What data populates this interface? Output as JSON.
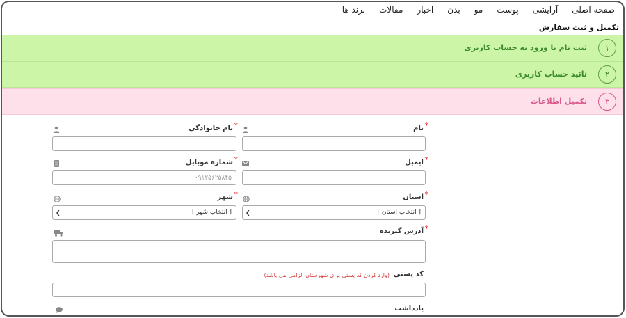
{
  "nav": {
    "items": [
      "صفحه اصلی",
      "آرایشی",
      "پوست",
      "مو",
      "بدن",
      "اخبار",
      "مقالات",
      "برند ها"
    ]
  },
  "page": {
    "title": "تکمیل و ثبت سفارش"
  },
  "steps": [
    {
      "num": "۱",
      "label": "ثبت نام یا ورود به حساب کاربری",
      "state": "done"
    },
    {
      "num": "۲",
      "label": "تائید حساب کاربری",
      "state": "done"
    },
    {
      "num": "۳",
      "label": "تکمیل اطلاعات",
      "state": "active"
    }
  ],
  "form": {
    "first_name": {
      "label": "نام",
      "required": "*",
      "value": ""
    },
    "last_name": {
      "label": "نام خانوادگی",
      "required": "*",
      "value": ""
    },
    "email": {
      "label": "ایمیل",
      "required": "*",
      "value": ""
    },
    "mobile": {
      "label": "شماره موبایل",
      "required": "*",
      "placeholder": "۰۹۱۲۵۶۲۵۸۴۵"
    },
    "province": {
      "label": "استان",
      "required": "*",
      "selected": "[ انتخاب استان ]"
    },
    "city": {
      "label": "شهر",
      "required": "*",
      "selected": "[ انتخاب شهر ]"
    },
    "address": {
      "label": "آدرس گیرنده",
      "required": "*"
    },
    "postal_code": {
      "label": "کد پستی",
      "hint": "(وارد کردن کد پستی برای شهرستان الزامی می باشد)"
    },
    "note": {
      "label": "یادداشت"
    }
  },
  "colors": {
    "step_done_bg": "#ccf5a8",
    "step_done_text": "#3d8b2a",
    "step_active_bg": "#fde0ea",
    "step_active_text": "#d9558a",
    "required": "#e03030"
  }
}
